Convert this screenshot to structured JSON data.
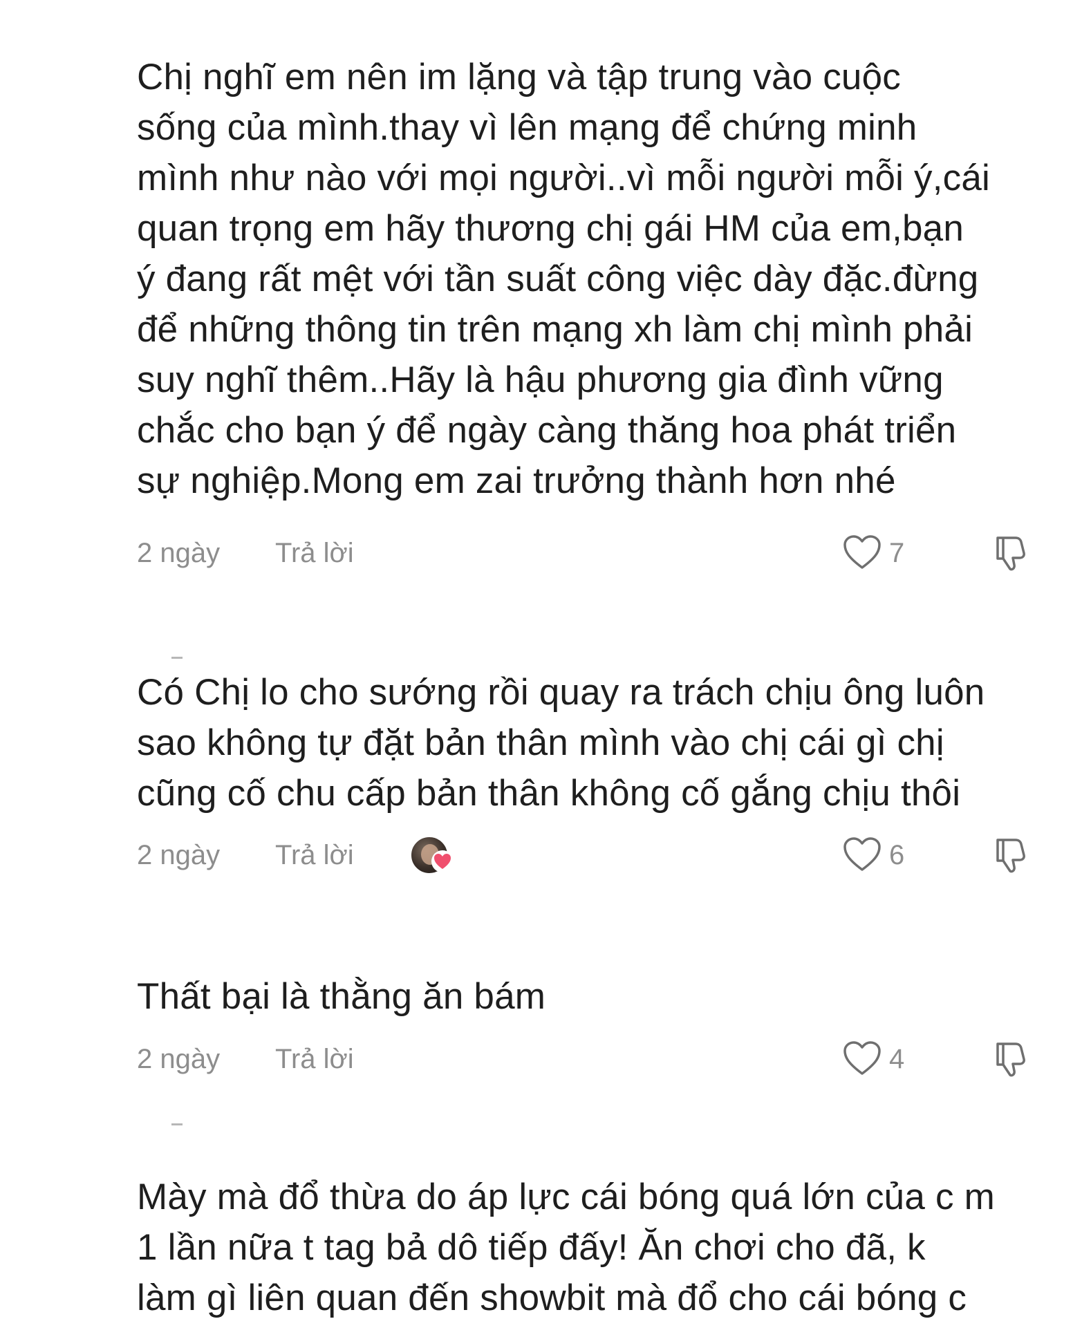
{
  "comments": [
    {
      "lines": [
        "Chị nghĩ em nên im lặng và tập trung vào cuộc",
        "sống của mình.thay vì lên mạng để chứng minh",
        "mình như nào với mọi người..vì mỗi người mỗi ý,cái",
        "quan trọng em hãy thương chị gái HM của em,bạn",
        "ý đang rất mệt với tần suất công việc dày đặc.đừng",
        "để những thông tin trên mạng xh làm chị mình phải",
        "suy nghĩ thêm..Hãy là hậu phương gia đình vững",
        "chắc cho bạn ý để ngày càng thăng hoa phát triển",
        "sự nghiệp.Mong em zai trưởng thành hơn nhé"
      ],
      "time": "2 ngày",
      "reply_label": "Trả lời",
      "likes": "7"
    },
    {
      "lines": [
        "Có Chị lo cho sướng rồi quay ra trách chịu ông luôn",
        "sao không tự đặt bản thân mình vào chị cái gì chị",
        "cũng cố chu cấp bản thân không cố gắng chịu thôi"
      ],
      "time": "2 ngày",
      "reply_label": "Trả lời",
      "likes": "6",
      "creator_liked": true
    },
    {
      "lines": [
        "Thất bại là thằng ăn bám"
      ],
      "time": "2 ngày",
      "reply_label": "Trả lời",
      "likes": "4"
    },
    {
      "lines": [
        "Mày mà đổ thừa do áp lực cái bóng quá lớn của c m",
        "1 lần nữa t tag bả dô tiếp đấy! Ăn chơi cho đã, k",
        "làm gì liên quan đến showbit mà đổ cho cái bóng c"
      ]
    }
  ],
  "icons": {
    "like": "heart-outline-icon",
    "dislike": "thumbs-down-icon",
    "creator_badge": "heart-filled-icon"
  },
  "colors": {
    "text": "#1e1e1e",
    "meta": "#8d8d8d",
    "heart_badge": "#f0506e"
  }
}
